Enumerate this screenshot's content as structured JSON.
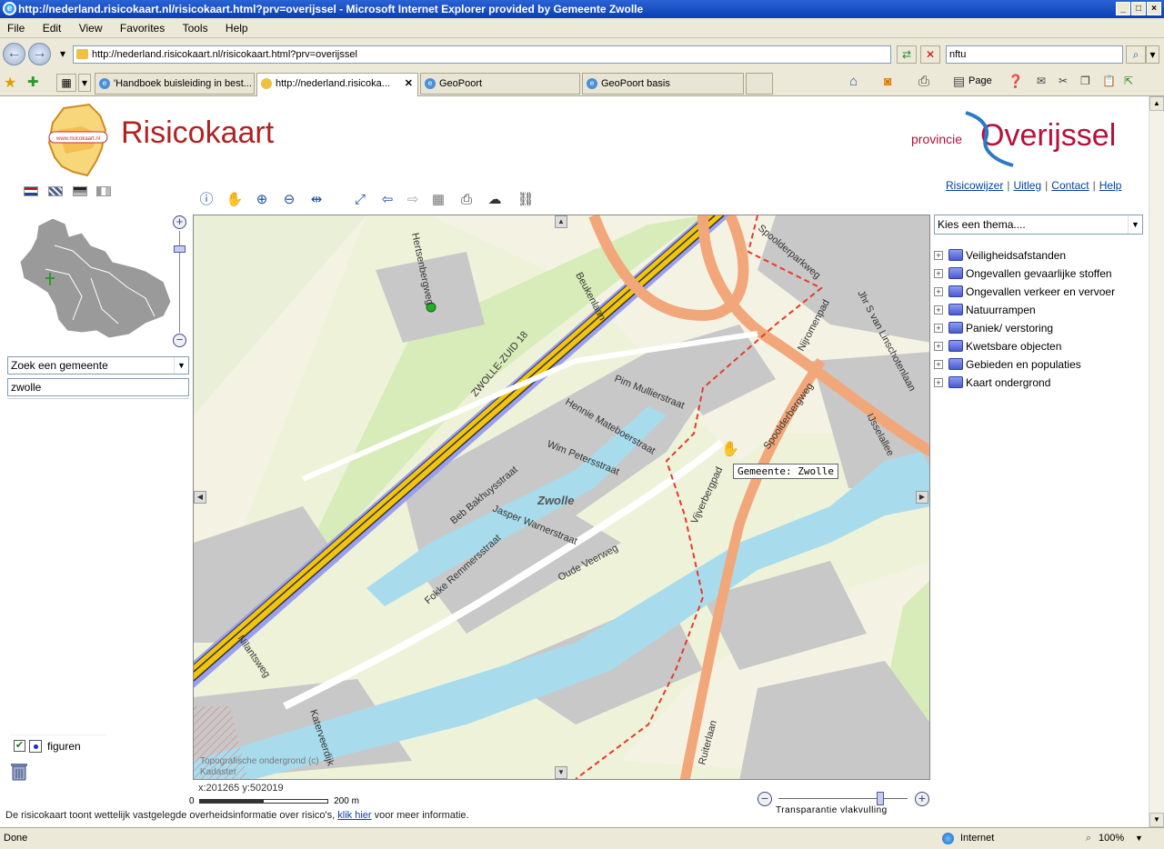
{
  "browser": {
    "title": "http://nederland.risicokaart.nl/risicokaart.html?prv=overijssel - Microsoft Internet Explorer provided by Gemeente Zwolle",
    "menu": [
      "File",
      "Edit",
      "View",
      "Favorites",
      "Tools",
      "Help"
    ],
    "address": "http://nederland.risicokaart.nl/risicokaart.html?prv=overijssel",
    "search_value": "nftu",
    "tabs": [
      {
        "label": "'Handboek buisleiding in best..."
      },
      {
        "label": "http://nederland.risicoka...",
        "active": true
      },
      {
        "label": "GeoPoort"
      },
      {
        "label": "GeoPoort basis"
      }
    ],
    "page_label": "Page",
    "status_left": "Done",
    "status_zone": "Internet",
    "zoom": "100%"
  },
  "header": {
    "logo_text": "Risicokaart",
    "logo_site": "www.risicokaart.nl",
    "province_small": "provincie",
    "province_big": "Overijssel"
  },
  "links": [
    "Risicowijzer",
    "Uitleg",
    "Contact",
    "Help"
  ],
  "left": {
    "gemeente_select": "Zoek een gemeente",
    "gemeente_input": "zwolle",
    "legend_label": "figuren"
  },
  "map": {
    "labels": {
      "hertsenbergweg": "Hertsenbergweg",
      "beukenlaan": "Beukenlaan",
      "spoolderparkweg": "Spoolderparkweg",
      "zwolle_zuid": "ZWOLLE-ZUID 18",
      "njiromenpad": "Nijromenpad",
      "linschoten": "Jhr S van Linschotenlaan",
      "mullier": "Pim Mullierstraat",
      "hennie": "Hennie Mateboerstraat",
      "wim": "Wim Petersstraat",
      "spoolderbergweg": "Spoolderbergweg",
      "ijsselallee": "IJsselallee",
      "beb": "Beb Bakhuysstraat",
      "zwolle": "Zwolle",
      "jasper": "Jasper Warnerstraat",
      "vijverbergpad": "Vijverbergpad",
      "fokke": "Fokke Remmersstraat",
      "oude_veerweg": "Oude Veerweg",
      "nilantsweg": "Nilantsweg",
      "katerveerdijk": "Katerveerdijk",
      "ruiterlaan": "Ruiterlaan",
      "attribution_1": "Topografische ondergrond (c)",
      "attribution_2": "Kadaster"
    },
    "tooltip": "Gemeente: Zwolle",
    "coords": "x:201265 y:502019",
    "scale_start": "0",
    "scale_end": "200 m",
    "transparency_label": "Transparantie vlakvulling"
  },
  "right": {
    "thema_select": "Kies een thema....",
    "tree": [
      "Veiligheidsafstanden",
      "Ongevallen gevaarlijke stoffen",
      "Ongevallen verkeer en vervoer",
      "Natuurrampen",
      "Paniek/ verstoring",
      "Kwetsbare objecten",
      "Gebieden en populaties",
      "Kaart ondergrond"
    ]
  },
  "footer": {
    "info_before": "De risicokaart toont wettelijk vastgelegde overheidsinformatie over risico's,",
    "info_link": "klik hier",
    "info_after": "voor meer informatie."
  },
  "colors": {
    "brand_red": "#b02323",
    "province_red": "#b5113a",
    "link_blue": "#0b3fa8",
    "highway_yellow": "#f1c40f",
    "highway_blue": "#9a9ef0",
    "road_orange": "#f2a77b",
    "water": "#a8dcec",
    "grass": "#d7ecb8",
    "urban": "#c6c6c6"
  }
}
